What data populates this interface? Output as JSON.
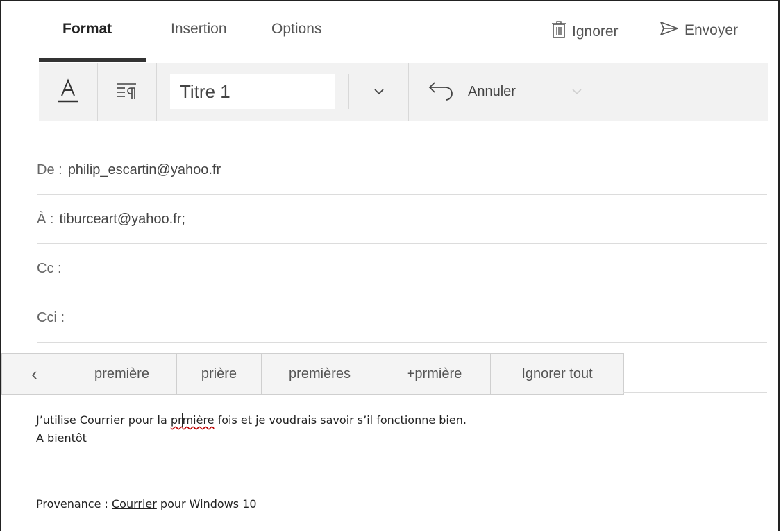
{
  "tabs": [
    {
      "label": "Format"
    },
    {
      "label": "Insertion"
    },
    {
      "label": "Options"
    }
  ],
  "actions": {
    "discard_label": "Ignorer",
    "send_label": "Envoyer"
  },
  "toolbar": {
    "font_format_icon": "text-color-icon",
    "paragraph_icon": "paragraph-format-icon",
    "style_value": "Titre 1",
    "undo_label": "Annuler"
  },
  "fields": {
    "from": {
      "label": "De :",
      "value": "philip_escartin@yahoo.fr"
    },
    "to": {
      "label": "À :",
      "value": "tiburceart@yahoo.fr;"
    },
    "cc": {
      "label": "Cc :",
      "value": ""
    },
    "bcc": {
      "label": "Cci :",
      "value": ""
    }
  },
  "suggestions": {
    "back_icon": "‹",
    "items": [
      "première",
      "prière",
      "premières",
      "+prmière"
    ],
    "ignore_all": "Ignorer tout"
  },
  "body": {
    "line1_before": "J’utilise Courrier pour la ",
    "misspelled_a": "pr",
    "misspelled_b": "mière",
    "line1_after": " fois et je voudrais savoir s’il fonctionne bien.",
    "line2": "A bientôt",
    "signature_prefix": "Provenance : ",
    "signature_link": "Courrier",
    "signature_suffix": " pour Windows 10"
  }
}
